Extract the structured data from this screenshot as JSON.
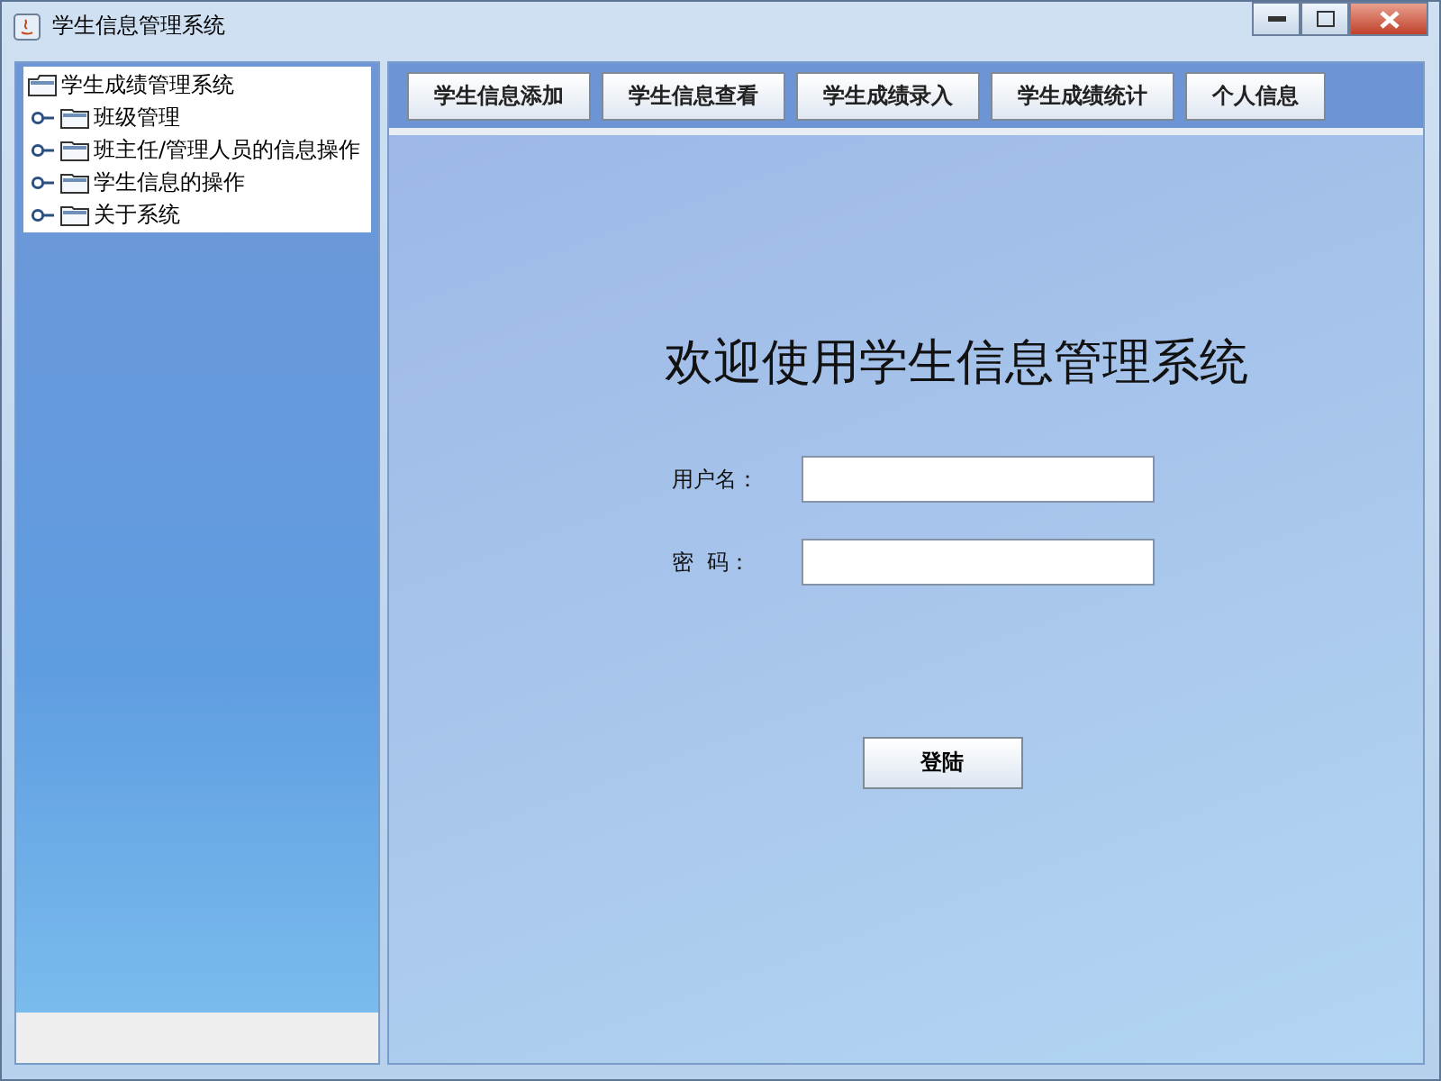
{
  "window": {
    "title": "学生信息管理系统"
  },
  "tree": {
    "label": "学生成绩管理系统",
    "expanded": true,
    "children": [
      {
        "label": "班级管理",
        "expanded": false
      },
      {
        "label": "班主任/管理人员的信息操作",
        "expanded": false
      },
      {
        "label": "学生信息的操作",
        "expanded": false
      },
      {
        "label": "关于系统",
        "expanded": false
      }
    ]
  },
  "toolbar": [
    "学生信息添加",
    "学生信息查看",
    "学生成绩录入",
    "学生成绩统计",
    "个人信息"
  ],
  "login": {
    "heading": "欢迎使用学生信息管理系统",
    "username_label": "用户名：",
    "password_label": "密  码：",
    "button": "登陆"
  }
}
